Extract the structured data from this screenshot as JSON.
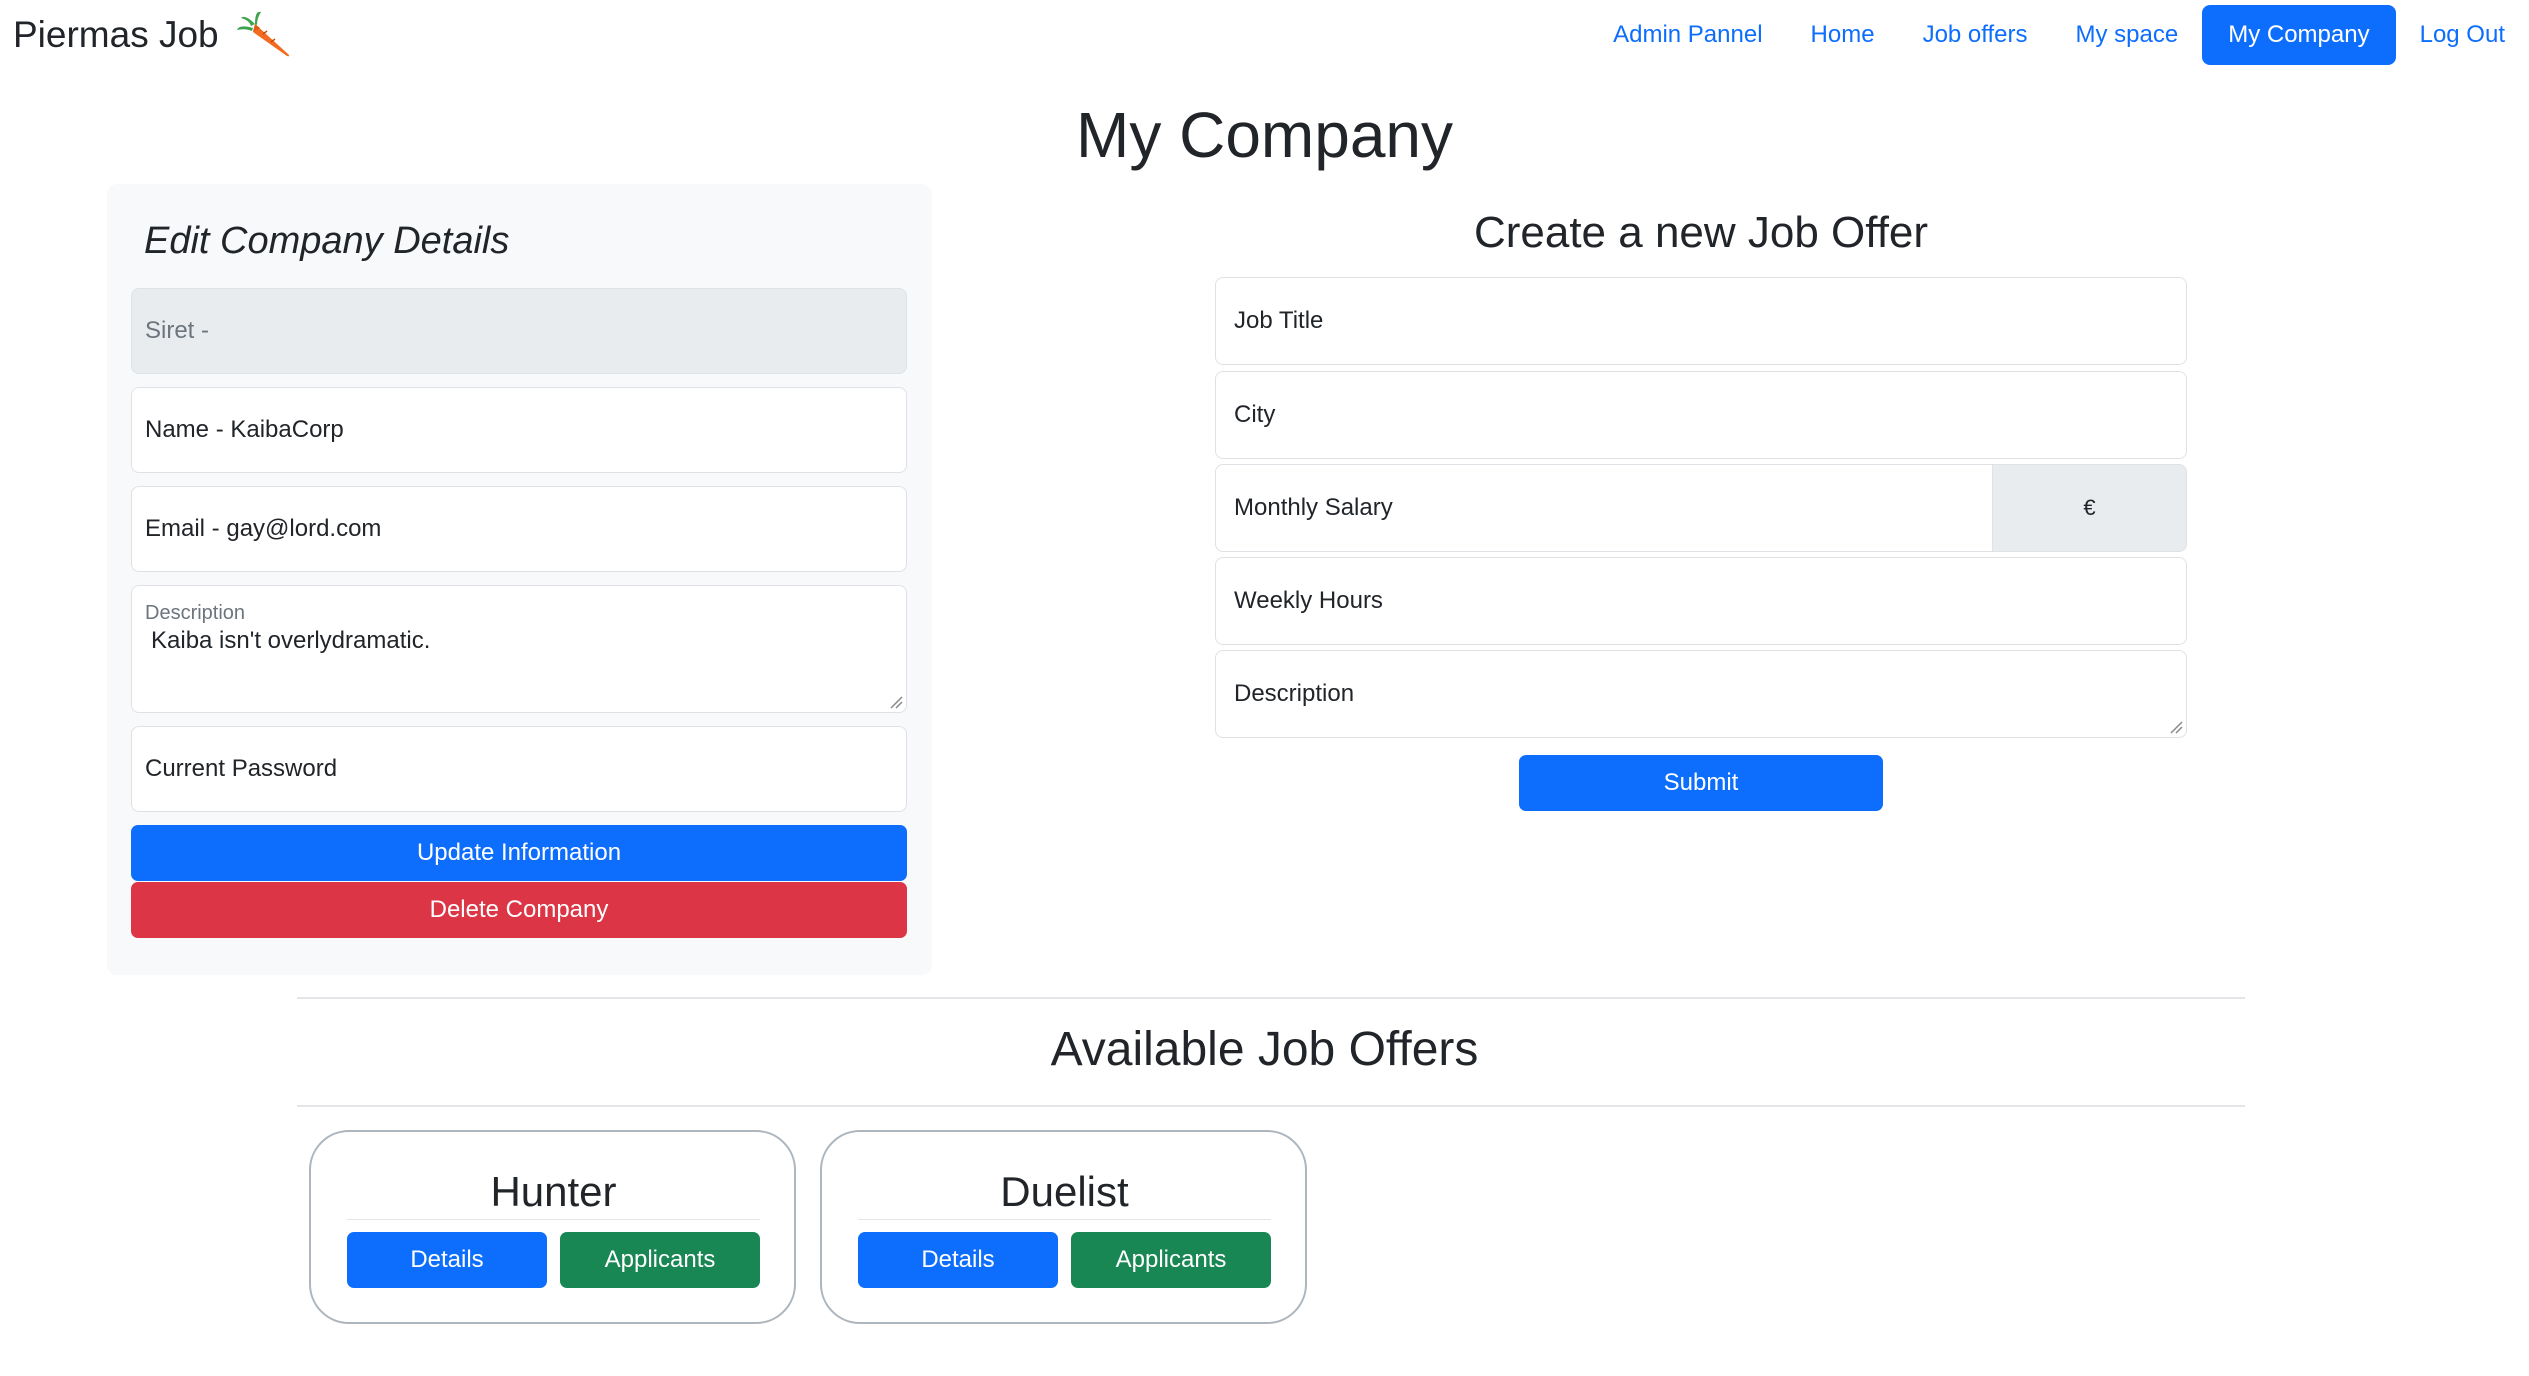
{
  "brand": {
    "name": "Piermas Job",
    "logo_icon": "carrot-icon"
  },
  "nav": [
    {
      "label": "Admin Pannel",
      "active": false
    },
    {
      "label": "Home",
      "active": false
    },
    {
      "label": "Job offers",
      "active": false
    },
    {
      "label": "My space",
      "active": false
    },
    {
      "label": "My Company",
      "active": true
    },
    {
      "label": "Log Out",
      "active": false
    }
  ],
  "page_title": "My Company",
  "edit": {
    "title": "Edit Company Details",
    "siret": "Siret -",
    "name": "Name - KaibaCorp",
    "email": "Email - gay@lord.com",
    "description_label": "Description",
    "description_value": "Kaiba isn't overlydramatic.",
    "password_placeholder": "Current Password",
    "update_label": "Update Information",
    "delete_label": "Delete Company"
  },
  "create": {
    "title": "Create a new Job Offer",
    "job_title_placeholder": "Job Title",
    "city_placeholder": "City",
    "salary_placeholder": "Monthly Salary",
    "currency": "€",
    "hours_placeholder": "Weekly Hours",
    "description_placeholder": "Description",
    "submit_label": "Submit"
  },
  "offers": {
    "title": "Available Job Offers",
    "items": [
      {
        "title": "Hunter",
        "details_label": "Details",
        "applicants_label": "Applicants"
      },
      {
        "title": "Duelist",
        "details_label": "Details",
        "applicants_label": "Applicants"
      }
    ]
  },
  "colors": {
    "primary": "#0d6efd",
    "danger": "#dc3545",
    "success": "#198754",
    "card_bg": "#f8f9fa"
  }
}
